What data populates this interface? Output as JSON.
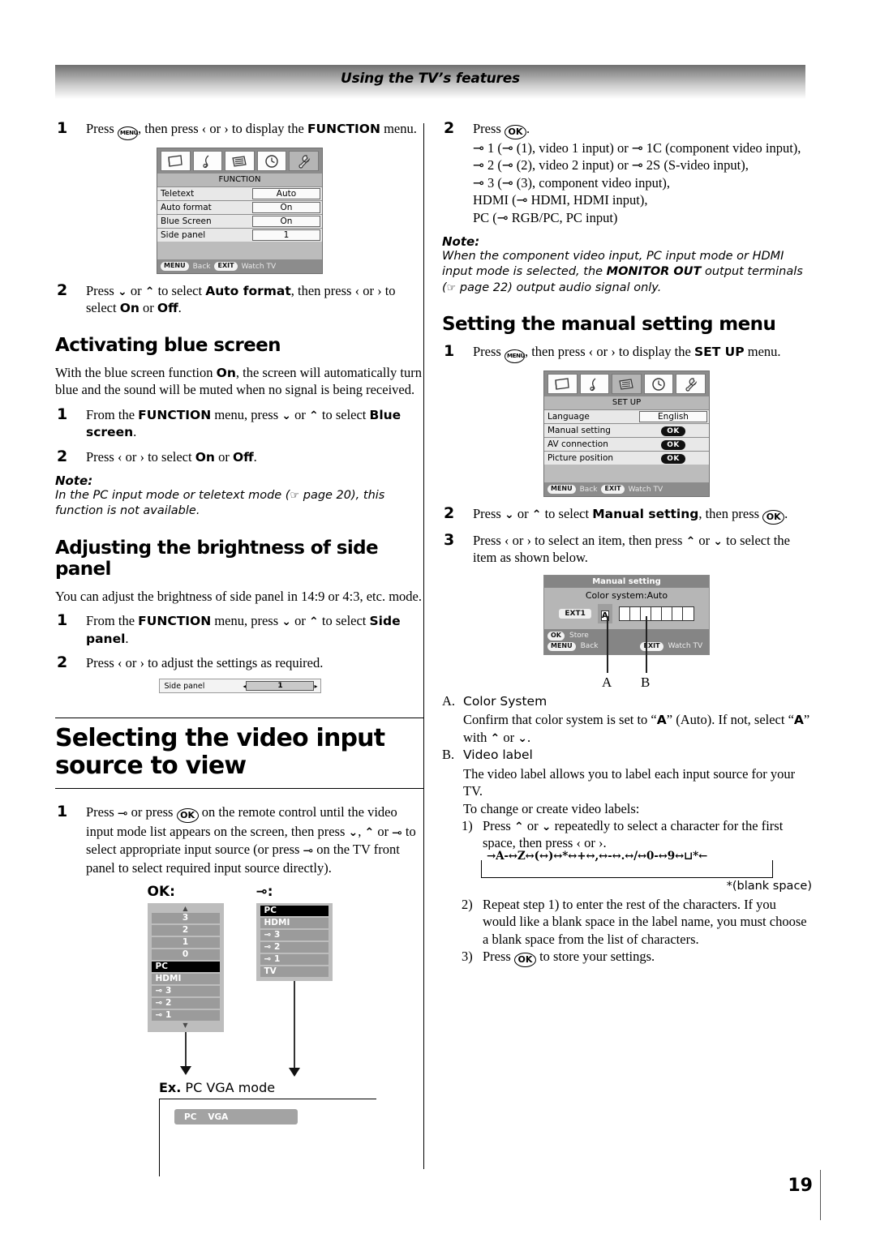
{
  "header": {
    "title": "Using the TV’s features"
  },
  "page_number": "19",
  "left": {
    "step1": {
      "num": "1",
      "pre": "Press ",
      "key": "MENU",
      "mid": ", then press ‹ or › to display the ",
      "bold": "FUNCTION",
      "post": " menu."
    },
    "function_menu": {
      "title": "FUNCTION",
      "icons": [
        "picture-icon",
        "sound-icon",
        "setup-icon",
        "timer-icon",
        "function-icon"
      ],
      "selected_icon_index": 4,
      "rows": [
        {
          "label": "Teletext",
          "value": "Auto"
        },
        {
          "label": "Auto format",
          "value": "On"
        },
        {
          "label": "Blue Screen",
          "value": "On"
        },
        {
          "label": "Side panel",
          "value": "1"
        }
      ],
      "footer": {
        "menu_key": "MENU",
        "menu_label": "Back",
        "exit_key": "EXIT",
        "exit_label": "Watch TV"
      }
    },
    "step2": {
      "num": "2",
      "t1": "Press ",
      "t2": " or ",
      "t3": " to select ",
      "b1": "Auto format",
      "t4": ", then press ‹ or › to select ",
      "b2": "On",
      "t5": " or ",
      "b3": "Off",
      "t6": "."
    },
    "heading_blue": "Activating blue screen",
    "blue_intro_a": "With the blue screen function ",
    "blue_intro_b": "On",
    "blue_intro_c": ", the screen will automatically turn blue and the sound will be muted when no signal is being received.",
    "blue_step1": {
      "num": "1",
      "t1": "From the ",
      "b1": "FUNCTION",
      "t2": " menu, press ",
      "t3": " or ",
      "t4": " to select ",
      "b2": "Blue screen",
      "t5": "."
    },
    "blue_step2": {
      "num": "2",
      "t1": "Press ‹ or › to select ",
      "b1": "On",
      "t2": " or ",
      "b2": "Off",
      "t3": "."
    },
    "note1": {
      "label": "Note:",
      "body_a": "In the PC input mode or teletext mode (",
      "hand": "☞",
      "body_b": " page 20), this function is not available."
    },
    "heading_sidepanel": "Adjusting the brightness of side panel",
    "sidepanel_intro": "You can adjust the brightness of side panel in 14:9 or 4:3, etc. mode.",
    "sp_step1": {
      "num": "1",
      "t1": "From the ",
      "b1": "FUNCTION",
      "t2": " menu, press ",
      "t3": " or ",
      "t4": " to select ",
      "b2": "Side panel",
      "t5": "."
    },
    "sp_step2": {
      "num": "2",
      "t1": "Press ‹ or › to adjust the settings as required."
    },
    "sidepanel_widget": {
      "label": "Side panel",
      "value": "1",
      "left_arrow": "◂",
      "right_arrow": "▸"
    },
    "heading_select_input": "Selecting the video input source to view",
    "sel_step1": {
      "num": "1",
      "t1": "Press ",
      "sym1": "⊸",
      "t2": " or press ",
      "okkey": "OK",
      "t3": " on the remote control until the video input mode list appears on the screen, then press ",
      "t4": ", ",
      "t5": " or ",
      "sym2": "⊸",
      "t6": " to select appropriate input source (or press ",
      "sym3": "⊸",
      "t7": " on the TV front panel to select required input source directly)."
    },
    "list_ok_header": "OK:",
    "list_input_header": "⊸:",
    "ok_list": {
      "scroll_up": "▲",
      "scroll_down": "▼",
      "items": [
        "3",
        "2",
        "1",
        "0",
        "PC",
        "HDMI",
        "⊸ 3",
        "⊸ 2",
        "⊸ 1"
      ],
      "selected": "PC"
    },
    "input_list": {
      "items": [
        "PC",
        "HDMI",
        "⊸ 3",
        "⊸ 2",
        "⊸ 1",
        "TV"
      ],
      "selected": "PC"
    },
    "ex_label_bold": "Ex.",
    "ex_label_rest": " PC VGA mode",
    "pcvga": {
      "left": "PC",
      "right": "VGA"
    }
  },
  "right": {
    "step2": {
      "num": "2",
      "t1": "Press ",
      "okkey": "OK",
      "t2": ".",
      "l1": "⊸ 1 (⊸ (1), video 1 input) or ⊸ 1C (component video input),",
      "l2": "⊸ 2 (⊸ (2), video 2 input) or ⊸ 2S (S-video input),",
      "l3": "⊸ 3 (⊸ (3), component video input),",
      "l4": "HDMI (⊸ HDMI, HDMI input),",
      "l5": "PC (⊸ RGB/PC, PC input)"
    },
    "note1": {
      "label": "Note:",
      "a": "When the component video input, PC input mode or HDMI input mode is selected, the ",
      "b": "MONITOR OUT",
      "c": " output terminals (",
      "hand": "☞",
      "d": " page 22) output audio signal only."
    },
    "heading_manual": "Setting the manual setting menu",
    "step1": {
      "num": "1",
      "t1": "Press ",
      "key": "MENU",
      "t2": ", then press ‹ or › to display the ",
      "b1": "SET UP",
      "t3": " menu."
    },
    "setup_menu": {
      "title": "SET UP",
      "icons": [
        "picture-icon",
        "sound-icon",
        "setup-icon",
        "timer-icon",
        "function-icon"
      ],
      "selected_icon_index": 2,
      "rows": [
        {
          "label": "Language",
          "value": "English",
          "type": "value"
        },
        {
          "label": "Manual setting",
          "value": "OK",
          "type": "ok"
        },
        {
          "label": "AV connection",
          "value": "OK",
          "type": "ok"
        },
        {
          "label": "Picture position",
          "value": "OK",
          "type": "ok"
        }
      ],
      "footer": {
        "menu_key": "MENU",
        "menu_label": "Back",
        "exit_key": "EXIT",
        "exit_label": "Watch TV"
      }
    },
    "step2b": {
      "num": "2",
      "t1": "Press ",
      "t2": " or ",
      "t3": " to select ",
      "b1": "Manual setting",
      "t4": ", then press ",
      "okkey": "OK",
      "t5": "."
    },
    "step3": {
      "num": "3",
      "t1": "Press ‹ or › to select an item, then press ",
      "t2": " or ",
      "t3": " to select the item as shown below."
    },
    "manual_setting_osd": {
      "title": "Manual setting",
      "subtitle": "Color system:Auto",
      "ext_label": "EXT1",
      "color_system_value": "A",
      "label_cells": 7,
      "footer_ok": "OK",
      "footer_ok_label": "Store",
      "footer_menu": "MENU",
      "footer_menu_label": "Back",
      "footer_exit": "EXIT",
      "footer_exit_label": "Watch TV"
    },
    "callout_a": "A",
    "callout_b": "B",
    "item_a": {
      "mark": "A.",
      "head": "Color System",
      "t1": "Confirm that color system is set to “",
      "b1": "A",
      "t2": "” (Auto). If not, select “",
      "b2": "A",
      "t3": "” with ",
      "t4": " or ",
      "t5": "."
    },
    "item_b": {
      "mark": "B.",
      "head": "Video label",
      "p1": "The video label allows you to label each input source for your TV.",
      "p2": "To change or create video labels:",
      "n1_mark": "1)",
      "n1_t1": "Press ",
      "n1_t2": " or ",
      "n1_t3": " repeatedly to select a character for the first space, then press ‹ or ›.",
      "n2_mark": "2)",
      "n2_text": "Repeat step 1) to enter the rest of the characters. If you would like a blank space in the label name, you must choose a blank space from the list of characters.",
      "n3_mark": "3)",
      "n3_t1": "Press ",
      "n3_ok": "OK",
      "n3_t2": " to store your settings."
    },
    "char_chain": "→A-↔Z↔(↔)↔*↔+↔,↔-↔.↔/↔0-↔9↔⊔*←",
    "blank_space_note": "*(blank space)"
  }
}
